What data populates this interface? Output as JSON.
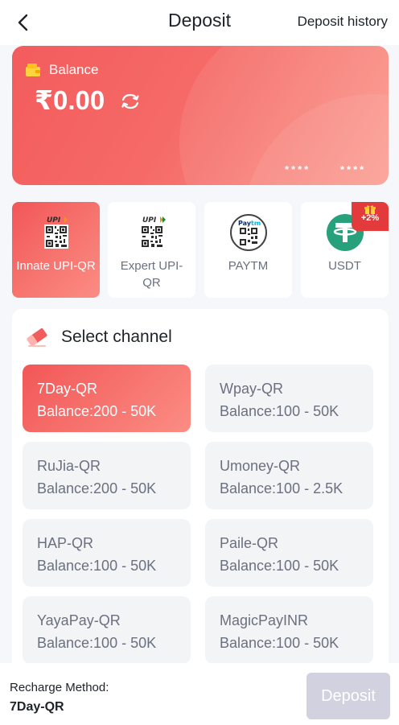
{
  "header": {
    "title": "Deposit",
    "history_label": "Deposit history"
  },
  "balance": {
    "label": "Balance",
    "amount": "₹0.00",
    "card_mask_1": "****",
    "card_mask_2": "****"
  },
  "methods": [
    {
      "label": "Innate UPI-QR",
      "icon": "upi-qr-icon",
      "active": true
    },
    {
      "label": "Expert UPI-QR",
      "icon": "upi-qr-icon",
      "active": false
    },
    {
      "label": "PAYTM",
      "icon": "paytm-qr-icon",
      "active": false
    },
    {
      "label": "USDT",
      "icon": "tether-icon",
      "active": false,
      "badge": "+2%"
    }
  ],
  "channel_section": {
    "title": "Select channel",
    "channels": [
      {
        "name": "7Day-QR",
        "range": "Balance:200 - 50K",
        "active": true
      },
      {
        "name": "Wpay-QR",
        "range": "Balance:100 - 50K",
        "active": false
      },
      {
        "name": "RuJia-QR",
        "range": "Balance:200 - 50K",
        "active": false
      },
      {
        "name": "Umoney-QR",
        "range": "Balance:100 - 2.5K",
        "active": false
      },
      {
        "name": "HAP-QR",
        "range": "Balance:100 - 50K",
        "active": false
      },
      {
        "name": "Paile-QR",
        "range": "Balance:100 - 50K",
        "active": false
      },
      {
        "name": "YayaPay-QR",
        "range": "Balance:100 - 50K",
        "active": false
      },
      {
        "name": "MagicPayINR",
        "range": "Balance:100 - 50K",
        "active": false
      }
    ]
  },
  "footer": {
    "method_caption": "Recharge Method:",
    "method_value": "7Day-QR",
    "deposit_label": "Deposit"
  },
  "colors": {
    "accent": "#f35c5c",
    "disabled_button": "#d1d1df",
    "usdt_green": "#26a17b"
  }
}
